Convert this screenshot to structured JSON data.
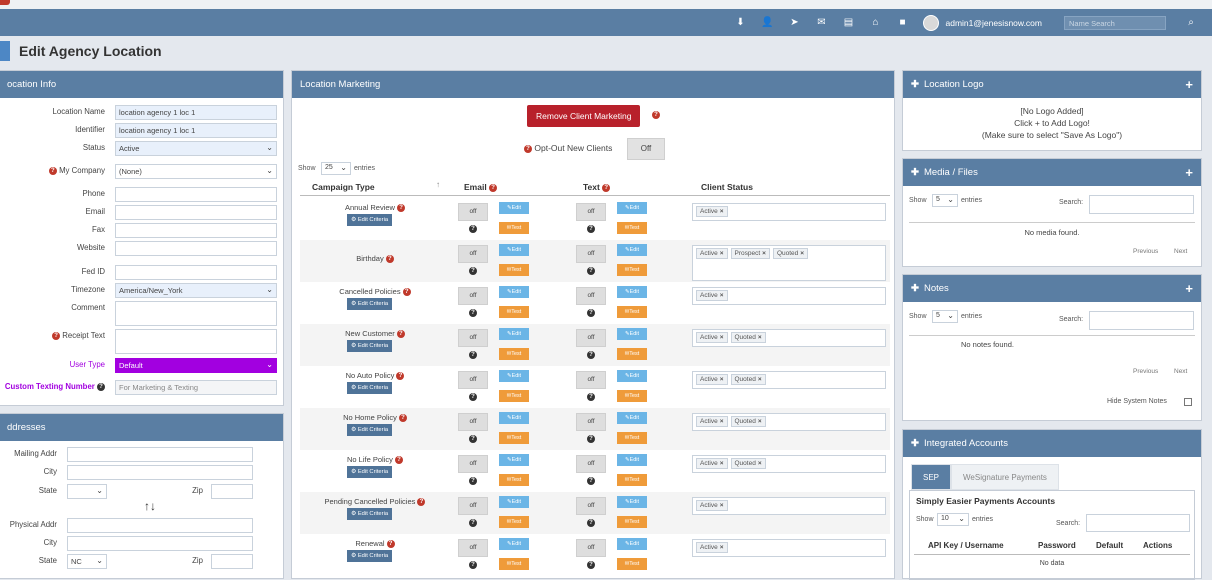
{
  "topbar": {
    "icons": [
      "download-icon",
      "add-user-icon",
      "send-icon",
      "mail-icon",
      "document-icon",
      "store-icon",
      "grid-icon"
    ],
    "user_email": "admin1@jenesisnow.com",
    "search_placeholder": "Name Search",
    "search_icon": "search-icon"
  },
  "page": {
    "title": "Edit Agency Location"
  },
  "location_info": {
    "header": "ocation Info",
    "fields": [
      {
        "label": "Location Name",
        "value": "location agency 1 loc 1"
      },
      {
        "label": "Identifier",
        "value": "location agency 1 loc 1"
      },
      {
        "label": "Status",
        "value": "Active"
      },
      {
        "label": "My Company",
        "value": "(None)"
      },
      {
        "label": "Phone",
        "value": ""
      },
      {
        "label": "Email",
        "value": ""
      },
      {
        "label": "Fax",
        "value": ""
      },
      {
        "label": "Website",
        "value": ""
      },
      {
        "label": "Fed ID",
        "value": ""
      },
      {
        "label": "Timezone",
        "value": "America/New_York"
      },
      {
        "label": "Comment",
        "value": ""
      },
      {
        "label": "Receipt Text",
        "value": ""
      },
      {
        "label": "User Type",
        "value": "Default"
      },
      {
        "label": "Custom Texting Number",
        "value": "",
        "placeholder": "For Marketing & Texting"
      }
    ]
  },
  "addresses": {
    "header": "ddresses",
    "mailing": {
      "addr": "Mailing Addr",
      "city": "City",
      "state": "State",
      "zip": "Zip"
    },
    "physical": {
      "addr": "Physical Addr",
      "city": "City",
      "state": "State",
      "state_value": "NC",
      "zip": "Zip"
    },
    "swap_icon": "↑↓"
  },
  "marketing": {
    "header": "Location Marketing",
    "remove_button": "Remove Client Marketing",
    "opt_out_label": "Opt-Out New Clients",
    "opt_out_value": "Off",
    "show_label": "Show",
    "show_value": "25",
    "entries_label": "entries",
    "columns": [
      "Campaign Type",
      "Email",
      "Text",
      "Client Status"
    ],
    "edit_criteria": "Edit Criteria",
    "off_label": "off",
    "edit_label": "Edit",
    "test_label": "Test",
    "rows": [
      {
        "name": "Annual Review",
        "status": [
          "Active"
        ]
      },
      {
        "name": "Birthday",
        "status": [
          "Active",
          "Prospect",
          "Quoted"
        ]
      },
      {
        "name": "Cancelled Policies",
        "status": [
          "Active"
        ]
      },
      {
        "name": "New Customer",
        "status": [
          "Active",
          "Quoted"
        ]
      },
      {
        "name": "No Auto Policy",
        "status": [
          "Active",
          "Quoted"
        ]
      },
      {
        "name": "No Home Policy",
        "status": [
          "Active",
          "Quoted"
        ]
      },
      {
        "name": "No Life Policy",
        "status": [
          "Active",
          "Quoted"
        ]
      },
      {
        "name": "Pending Cancelled Policies",
        "status": [
          "Active"
        ]
      },
      {
        "name": "Renewal",
        "status": [
          "Active"
        ]
      }
    ]
  },
  "logo": {
    "header": "Location Logo",
    "line1": "[No Logo Added]",
    "line2": "Click + to Add Logo!",
    "line3": "(Make sure to select \"Save As Logo\")"
  },
  "media": {
    "header": "Media / Files",
    "show_label": "Show",
    "show_value": "5",
    "entries_label": "entries",
    "search_label": "Search:",
    "empty": "No media found.",
    "previous": "Previous",
    "next": "Next"
  },
  "notes": {
    "header": "Notes",
    "show_label": "Show",
    "show_value": "5",
    "entries_label": "entries",
    "search_label": "Search:",
    "empty": "No notes found.",
    "previous": "Previous",
    "next": "Next",
    "hide_system": "Hide System Notes"
  },
  "integrated": {
    "header": "Integrated Accounts",
    "tabs": [
      "SEP",
      "WeSignature Payments"
    ],
    "subheader": "Simply Easier Payments Accounts",
    "show_label": "Show",
    "show_value": "10",
    "entries_label": "entries",
    "search_label": "Search:",
    "columns": [
      "API Key / Username",
      "Password",
      "Default",
      "Actions"
    ],
    "empty": "No data"
  }
}
